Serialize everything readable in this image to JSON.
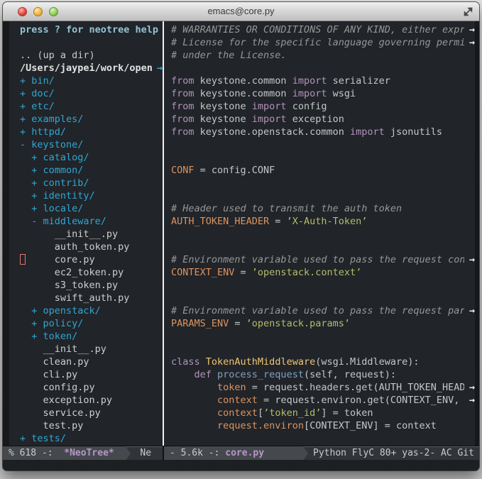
{
  "app": {
    "title": "emacs@core.py"
  },
  "glyphs": {
    "continuation": "→"
  },
  "colors": {
    "background": "#212429",
    "foreground": "#c5c8c6",
    "comment": "#969896",
    "keyword": "#b294bb",
    "string": "#b5bd68",
    "variable": "#de935f",
    "class_name": "#f0c674",
    "function_name": "#81a2be",
    "directory_cyan": "#2fa7d3",
    "modeline_buffer": "#b796c6",
    "cursor_hollow": "#e0766e"
  },
  "sidebar": {
    "help_text": "press ? for neotree help",
    "lines": [
      {
        "text": "press ? for neotree help",
        "style": "help"
      },
      {
        "text": "",
        "style": "plain"
      },
      {
        "text": ".. (up a dir)",
        "style": "plain"
      },
      {
        "text": "/Users/jaypei/work/opens",
        "style": "path",
        "arrow": true
      },
      {
        "text": "+ bin/",
        "style": "dir"
      },
      {
        "text": "+ doc/",
        "style": "dir"
      },
      {
        "text": "+ etc/",
        "style": "dir"
      },
      {
        "text": "+ examples/",
        "style": "dir"
      },
      {
        "text": "+ httpd/",
        "style": "dir"
      },
      {
        "text": "- keystone/",
        "style": "dir"
      },
      {
        "text": "  + catalog/",
        "style": "dir"
      },
      {
        "text": "  + common/",
        "style": "dir"
      },
      {
        "text": "  + contrib/",
        "style": "dir"
      },
      {
        "text": "  + identity/",
        "style": "dir"
      },
      {
        "text": "  + locale/",
        "style": "dir"
      },
      {
        "text": "  - middleware/",
        "style": "dir"
      },
      {
        "text": "      __init__.py",
        "style": "file"
      },
      {
        "text": "      auth_token.py",
        "style": "file"
      },
      {
        "text": "      core.py",
        "style": "file",
        "cursor": true
      },
      {
        "text": "      ec2_token.py",
        "style": "file"
      },
      {
        "text": "      s3_token.py",
        "style": "file"
      },
      {
        "text": "      swift_auth.py",
        "style": "file"
      },
      {
        "text": "  + openstack/",
        "style": "dir"
      },
      {
        "text": "  + policy/",
        "style": "dir"
      },
      {
        "text": "  + token/",
        "style": "dir"
      },
      {
        "text": "    __init__.py",
        "style": "file"
      },
      {
        "text": "    clean.py",
        "style": "file"
      },
      {
        "text": "    cli.py",
        "style": "file"
      },
      {
        "text": "    config.py",
        "style": "file"
      },
      {
        "text": "    exception.py",
        "style": "file"
      },
      {
        "text": "    service.py",
        "style": "file"
      },
      {
        "text": "    test.py",
        "style": "file"
      },
      {
        "text": "+ tests/",
        "style": "dir"
      }
    ]
  },
  "editor": {
    "lines": [
      {
        "segments": [
          [
            "com",
            "# WARRANTIES OR CONDITIONS OF ANY KIND, either expre"
          ]
        ],
        "overflow": true
      },
      {
        "segments": [
          [
            "com",
            "# License for the specific language governing permis"
          ]
        ],
        "overflow": true
      },
      {
        "segments": [
          [
            "com",
            "# under the License."
          ]
        ]
      },
      {
        "segments": []
      },
      {
        "segments": [
          [
            "kw",
            "from "
          ],
          [
            "plain",
            "keystone.common "
          ],
          [
            "kw",
            "import "
          ],
          [
            "plain",
            "serializer"
          ]
        ]
      },
      {
        "segments": [
          [
            "kw",
            "from "
          ],
          [
            "plain",
            "keystone.common "
          ],
          [
            "kw",
            "import "
          ],
          [
            "plain",
            "wsgi"
          ]
        ]
      },
      {
        "segments": [
          [
            "kw",
            "from "
          ],
          [
            "plain",
            "keystone "
          ],
          [
            "kw",
            "import "
          ],
          [
            "plain",
            "config"
          ]
        ]
      },
      {
        "segments": [
          [
            "kw",
            "from "
          ],
          [
            "plain",
            "keystone "
          ],
          [
            "kw",
            "import "
          ],
          [
            "plain",
            "exception"
          ]
        ]
      },
      {
        "segments": [
          [
            "kw",
            "from "
          ],
          [
            "plain",
            "keystone.openstack.common "
          ],
          [
            "kw",
            "import "
          ],
          [
            "plain",
            "jsonutils"
          ]
        ]
      },
      {
        "segments": []
      },
      {
        "segments": []
      },
      {
        "segments": [
          [
            "var",
            "CONF"
          ],
          [
            "plain",
            " = config.CONF"
          ]
        ]
      },
      {
        "segments": []
      },
      {
        "segments": []
      },
      {
        "segments": [
          [
            "com",
            "# Header used to transmit the auth token"
          ]
        ]
      },
      {
        "segments": [
          [
            "var",
            "AUTH_TOKEN_HEADER"
          ],
          [
            "plain",
            " = "
          ],
          [
            "str",
            "’X-Auth-Token’"
          ]
        ]
      },
      {
        "segments": []
      },
      {
        "segments": []
      },
      {
        "segments": [
          [
            "com",
            "# Environment variable used to pass the request cont"
          ]
        ],
        "overflow": true
      },
      {
        "segments": [
          [
            "var",
            "CONTEXT_ENV"
          ],
          [
            "plain",
            " = "
          ],
          [
            "str",
            "’openstack.context’"
          ]
        ]
      },
      {
        "segments": []
      },
      {
        "segments": []
      },
      {
        "segments": [
          [
            "com",
            "# Environment variable used to pass the request para"
          ]
        ],
        "overflow": true
      },
      {
        "segments": [
          [
            "var",
            "PARAMS_ENV"
          ],
          [
            "plain",
            " = "
          ],
          [
            "str",
            "’openstack.params’"
          ]
        ]
      },
      {
        "segments": []
      },
      {
        "segments": []
      },
      {
        "segments": [
          [
            "kw",
            "class "
          ],
          [
            "cls",
            "TokenAuthMiddleware"
          ],
          [
            "plain",
            "(wsgi.Middleware):"
          ]
        ]
      },
      {
        "segments": [
          [
            "plain",
            "    "
          ],
          [
            "kw",
            "def "
          ],
          [
            "fn",
            "process_request"
          ],
          [
            "plain",
            "(self, request):"
          ]
        ]
      },
      {
        "segments": [
          [
            "plain",
            "        "
          ],
          [
            "var",
            "token"
          ],
          [
            "plain",
            " = request.headers.get(AUTH_TOKEN_HEADE"
          ]
        ],
        "overflow": true
      },
      {
        "segments": [
          [
            "plain",
            "        "
          ],
          [
            "var",
            "context"
          ],
          [
            "plain",
            " = request.environ.get(CONTEXT_ENV, {"
          ]
        ],
        "overflow": true
      },
      {
        "segments": [
          [
            "plain",
            "        "
          ],
          [
            "var",
            "context"
          ],
          [
            "plain",
            "["
          ],
          [
            "str",
            "’token_id’"
          ],
          [
            "plain",
            "] = token"
          ]
        ]
      },
      {
        "segments": [
          [
            "plain",
            "        "
          ],
          [
            "var",
            "request.environ"
          ],
          [
            "plain",
            "[CONTEXT_ENV] = context"
          ]
        ]
      }
    ]
  },
  "modeline": {
    "left": {
      "position": "% 618 -:",
      "buffer": "*NeoTree*",
      "overflow_text": "Ne"
    },
    "right": {
      "size_info": "- 5.6k -:",
      "buffer": "core.py",
      "modes": "Python FlyC 80+ yas-2- AC Git"
    }
  }
}
